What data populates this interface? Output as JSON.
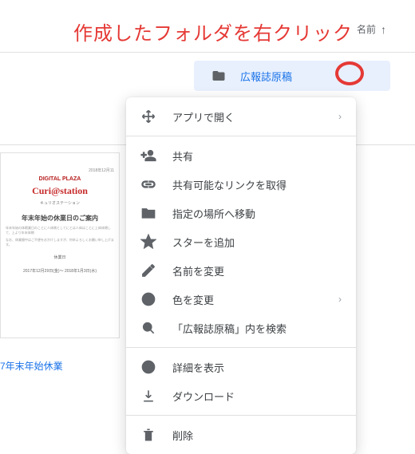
{
  "header": {
    "sort_label": "名前"
  },
  "annotation": {
    "text": "作成したフォルダを右クリック"
  },
  "folder": {
    "name": "広報誌原稿"
  },
  "thumbnail": {
    "date_corner": "2018年12月11",
    "logo_top": "DIGITAL PLAZA",
    "logo_script": "Curi@station",
    "logo_sub": "キュリオステーション",
    "title": "年末年始の休業日のご案内",
    "para1": "年末年始の体暇業日のことに人体側としてにとは人体はことに上体体閉して、上より年末体閉",
    "para2": "なお、休業間中はご不便をおかけしますが、何卒よろしくお願い申し上げます。",
    "closing_label": "休業日",
    "closing_dates": "2017年12月29日(金)～\n2018年1月3日(水)"
  },
  "caption": {
    "text": "7年末年始休業"
  },
  "menu": {
    "open_with": "アプリで開く",
    "share": "共有",
    "get_link": "共有可能なリンクを取得",
    "move": "指定の場所へ移動",
    "star": "スターを追加",
    "rename": "名前を変更",
    "color": "色を変更",
    "search_in": "「広報誌原稿」内を検索",
    "details": "詳細を表示",
    "download": "ダウンロード",
    "delete": "削除"
  }
}
